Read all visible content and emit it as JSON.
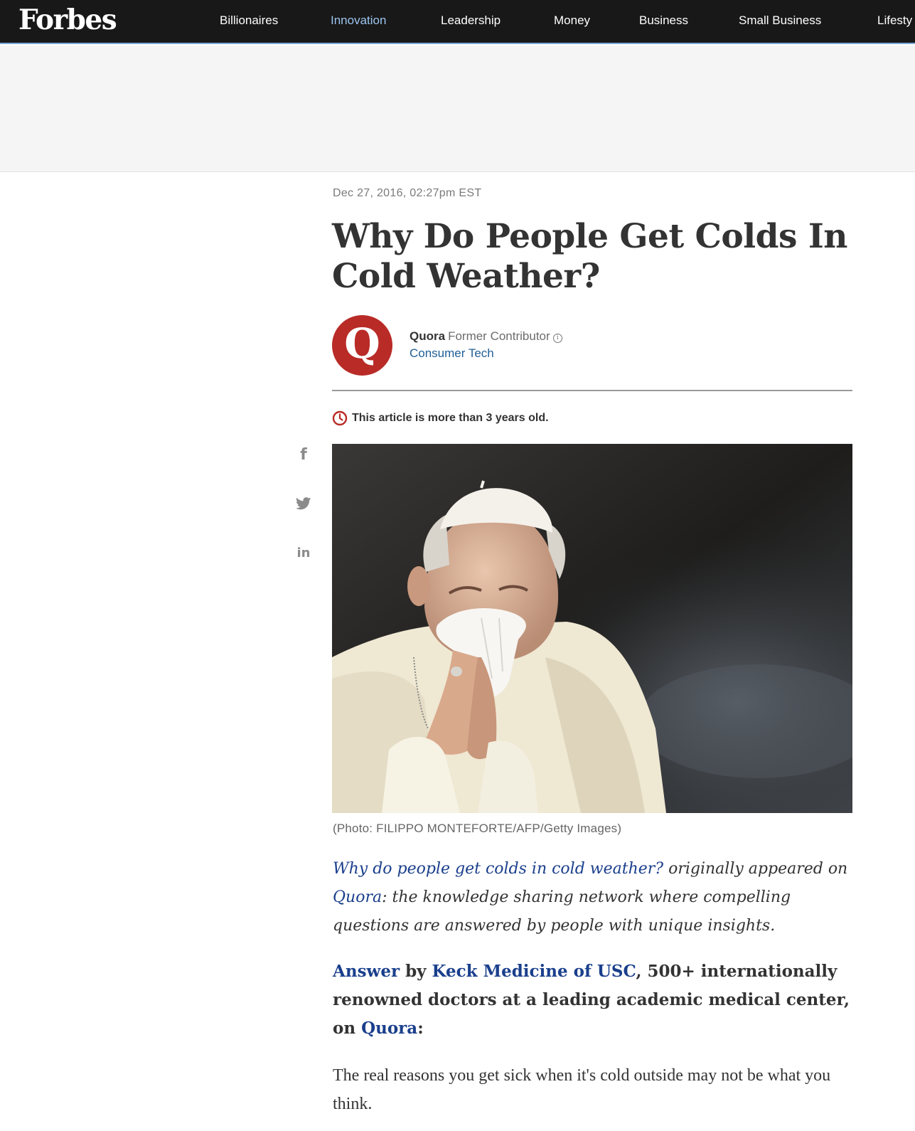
{
  "header": {
    "logo": "Forbes",
    "nav": [
      {
        "label": "Billionaires"
      },
      {
        "label": "Innovation"
      },
      {
        "label": "Leadership"
      },
      {
        "label": "Money"
      },
      {
        "label": "Business"
      },
      {
        "label": "Small Business"
      },
      {
        "label": "Lifesty"
      }
    ],
    "active_nav": "Innovation"
  },
  "article": {
    "date": "Dec 27, 2016, 02:27pm EST",
    "title": "Why Do People Get Colds In Cold Weather?",
    "author": {
      "avatar_letter": "Q",
      "name": "Quora",
      "role": "Former Contributor",
      "channel": "Consumer Tech"
    },
    "age_notice": "This article is more than 3 years old.",
    "share": {
      "facebook": "f",
      "linkedin": "in"
    },
    "photo_caption": "(Photo: FILIPPO MONTEFORTE/AFP/Getty Images)",
    "intro": {
      "link_text": "Why do people get colds in cold weather?",
      "text_1": " originally appeared on ",
      "quora_link": "Quora",
      "text_2": ": the knowledge sharing network where compelling questions are answered by people with unique insights."
    },
    "answer": {
      "answer_link": "Answer",
      "by": " by ",
      "keck_link": "Keck Medicine of USC",
      "description": ", 500+ internationally renowned doctors at a leading academic medical center, on ",
      "quora_link": "Quora",
      "colon": ":"
    },
    "body_para": "The real reasons you get sick when it's cold outside may not be what you think."
  },
  "colors": {
    "nav_bg": "#181818",
    "nav_active": "#9cc4ee",
    "quora_red": "#b92b27",
    "link_blue": "#1a3f8c",
    "channel_blue": "#1f5e96",
    "ad_bg": "#f5f5f5"
  }
}
